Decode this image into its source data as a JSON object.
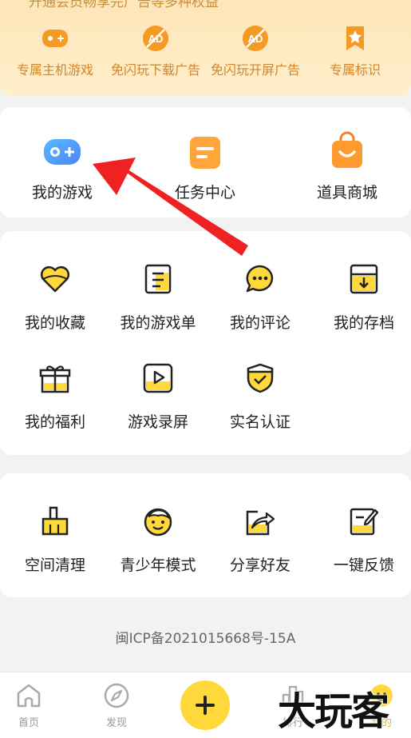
{
  "vip": {
    "subtitle": "开通会员畅享完广告等多种权益",
    "items": [
      {
        "label": "专属主机游戏",
        "icon": "gamepad-icon"
      },
      {
        "label": "免闪玩下载广告",
        "icon": "no-ad-icon"
      },
      {
        "label": "免闪玩开屏广告",
        "icon": "no-ad-icon"
      },
      {
        "label": "专属标识",
        "icon": "star-badge-icon"
      }
    ]
  },
  "main_shortcuts": [
    {
      "label": "我的游戏",
      "icon": "gamepad-icon"
    },
    {
      "label": "任务中心",
      "icon": "task-icon"
    },
    {
      "label": "道具商城",
      "icon": "shop-bag-icon"
    }
  ],
  "features": [
    {
      "label": "我的收藏",
      "icon": "heart-icon"
    },
    {
      "label": "我的游戏单",
      "icon": "game-list-icon"
    },
    {
      "label": "我的评论",
      "icon": "comment-icon"
    },
    {
      "label": "我的存档",
      "icon": "archive-icon"
    },
    {
      "label": "我的福利",
      "icon": "gift-icon"
    },
    {
      "label": "游戏录屏",
      "icon": "record-icon"
    },
    {
      "label": "实名认证",
      "icon": "shield-icon"
    }
  ],
  "tools": [
    {
      "label": "空间清理",
      "icon": "broom-icon"
    },
    {
      "label": "青少年模式",
      "icon": "child-face-icon"
    },
    {
      "label": "分享好友",
      "icon": "share-icon"
    },
    {
      "label": "一键反馈",
      "icon": "feedback-icon"
    }
  ],
  "icp": "闽ICP备2021015668号-15A",
  "tabs": [
    {
      "label": "首页",
      "icon": "home-icon"
    },
    {
      "label": "发现",
      "icon": "compass-icon"
    },
    {
      "label": "排行",
      "icon": "rank-icon"
    },
    {
      "label": "我的",
      "icon": "profile-icon"
    }
  ],
  "watermark": "大玩客",
  "colors": {
    "accent": "#ffd83c",
    "vip_text": "#d2852a",
    "arrow": "#ee2222"
  }
}
